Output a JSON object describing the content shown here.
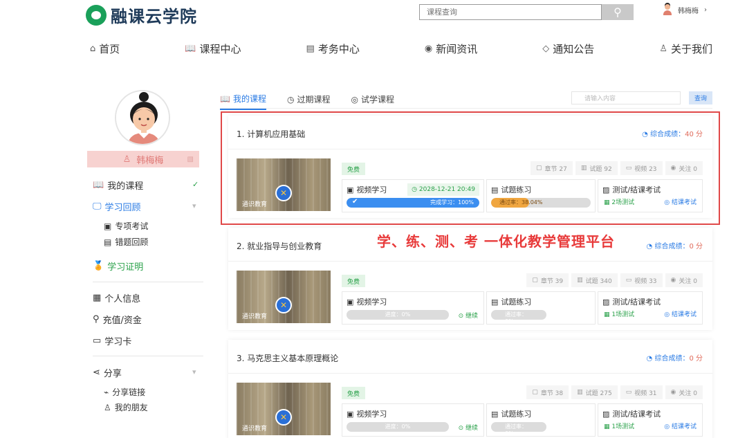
{
  "brand": {
    "name": "融课云学院"
  },
  "search": {
    "placeholder": "课程查询"
  },
  "user": {
    "name": "韩梅梅",
    "arrow": "›"
  },
  "nav": [
    {
      "label": "首页",
      "icon": "⌂"
    },
    {
      "label": "课程中心",
      "icon": "📖"
    },
    {
      "label": "考务中心",
      "icon": "▤"
    },
    {
      "label": "新闻资讯",
      "icon": "◉"
    },
    {
      "label": "通知公告",
      "icon": "◇"
    },
    {
      "label": "关于我们",
      "icon": "♙"
    }
  ],
  "sidebar": {
    "username": "韩梅梅",
    "my_courses": "我的课程",
    "review": "学习回顾",
    "special_exam": "专项考试",
    "wrong_review": "错题回顾",
    "certificate": "学习证明",
    "profile": "个人信息",
    "recharge": "充值/资金",
    "study_card": "学习卡",
    "share": "分享",
    "share_link": "分享链接",
    "my_friends": "我的朋友"
  },
  "tabs": {
    "mine": "我的课程",
    "expired": "过期课程",
    "trial": "试学课程",
    "search_placeholder": "请输入内容",
    "search_btn": "查询"
  },
  "slogan": "学、练、测、考 一体化教学管理平台",
  "labels": {
    "score": "综合成绩：",
    "free": "免费",
    "video": "视频学习",
    "practice": "试题练习",
    "test": "测试/结课考试",
    "final_exam": "结课考试",
    "continue": "继续",
    "thumb_caption": "通识教育"
  },
  "courses": [
    {
      "title": "1. 计算机应用基础",
      "score": "40 分",
      "chapters": "章节 27",
      "questions": "试题 92",
      "videos": "视频 23",
      "follows": "关注 0",
      "date": "2028-12-21 20:49",
      "video_label": "完成学习：100%",
      "video_progress": 1.0,
      "practice_label": "通过率：38.04%",
      "practice_progress": 0.3804,
      "tests": "2场测试"
    },
    {
      "title": "2. 就业指导与创业教育",
      "score": "0 分",
      "chapters": "章节 39",
      "questions": "试题 340",
      "videos": "视频 33",
      "follows": "关注 0",
      "video_label": "进度：0%",
      "video_progress": 0,
      "practice_label": "通过率：0%",
      "practice_progress": 0,
      "tests": "1场测试"
    },
    {
      "title": "3. 马克思主义基本原理概论",
      "score": "0 分",
      "chapters": "章节 38",
      "questions": "试题 275",
      "videos": "视频 31",
      "follows": "关注 0",
      "video_label": "进度：0%",
      "video_progress": 0,
      "practice_label": "通过率：0%",
      "practice_progress": 0,
      "tests": "1场测试"
    }
  ],
  "colors": {
    "accent": "#2a7be4",
    "green": "#2aa14a",
    "red": "#e04848",
    "progress": "#3b8ef0",
    "practice": "#f0a640"
  }
}
